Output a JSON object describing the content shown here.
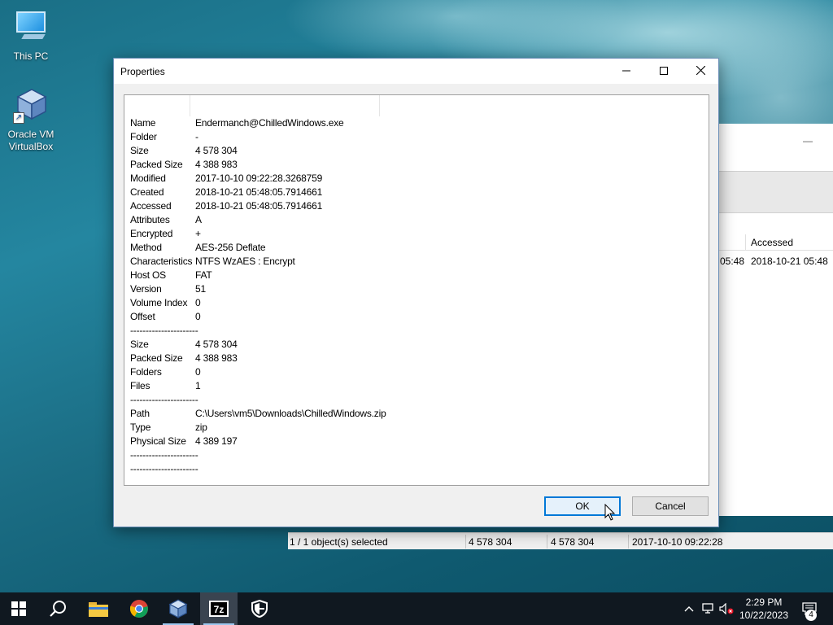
{
  "desktop": {
    "icons": [
      {
        "label_line1": "This PC",
        "label_line2": ""
      },
      {
        "label_line1": "Oracle VM",
        "label_line2": "VirtualBox"
      }
    ]
  },
  "bg_window": {
    "column_accessed": "Accessed",
    "row_partial": "05:48",
    "row_accessed": "2018-10-21 05:48",
    "minimize_glyph": "—"
  },
  "statusbar": {
    "selection": "1 / 1 object(s) selected",
    "size": "4 578 304",
    "packed": "4 578 304",
    "modified": "2017-10-10 09:22:28"
  },
  "dialog": {
    "title": "Properties",
    "ok_label": "OK",
    "cancel_label": "Cancel",
    "properties": [
      {
        "key": "Name",
        "value": "Endermanch@ChilledWindows.exe"
      },
      {
        "key": "Folder",
        "value": "-"
      },
      {
        "key": "Size",
        "value": "4 578 304"
      },
      {
        "key": "Packed Size",
        "value": "4 388 983"
      },
      {
        "key": "Modified",
        "value": "2017-10-10 09:22:28.3268759"
      },
      {
        "key": "Created",
        "value": "2018-10-21 05:48:05.7914661"
      },
      {
        "key": "Accessed",
        "value": "2018-10-21 05:48:05.7914661"
      },
      {
        "key": "Attributes",
        "value": "A"
      },
      {
        "key": "Encrypted",
        "value": "+"
      },
      {
        "key": "Method",
        "value": "AES-256 Deflate"
      },
      {
        "key": "Characteristics",
        "value": "NTFS WzAES : Encrypt"
      },
      {
        "key": "Host OS",
        "value": "FAT"
      },
      {
        "key": "Version",
        "value": "51"
      },
      {
        "key": "Volume Index",
        "value": "0"
      },
      {
        "key": "Offset",
        "value": "0"
      },
      {
        "key": "----------------------",
        "value": ""
      },
      {
        "key": "Size",
        "value": "4 578 304"
      },
      {
        "key": "Packed Size",
        "value": "4 388 983"
      },
      {
        "key": "Folders",
        "value": "0"
      },
      {
        "key": "Files",
        "value": "1"
      },
      {
        "key": "----------------------",
        "value": ""
      },
      {
        "key": "Path",
        "value": "C:\\Users\\vm5\\Downloads\\ChilledWindows.zip"
      },
      {
        "key": "Type",
        "value": "zip"
      },
      {
        "key": "Physical Size",
        "value": "4 389 197"
      },
      {
        "key": "----------------------",
        "value": ""
      },
      {
        "key": "----------------------",
        "value": ""
      }
    ]
  },
  "taskbar": {
    "clock_time": "2:29 PM",
    "clock_date": "10/22/2023",
    "notification_count": "4",
    "items": [
      "start-icon",
      "search-icon",
      "file-explorer-icon",
      "chrome-icon",
      "virtualbox-icon",
      "7zip-icon",
      "security-shield-icon"
    ]
  },
  "colors": {
    "accent": "#0078d7",
    "taskbar": "#101820",
    "dialog_bg": "#f0f0f0"
  }
}
